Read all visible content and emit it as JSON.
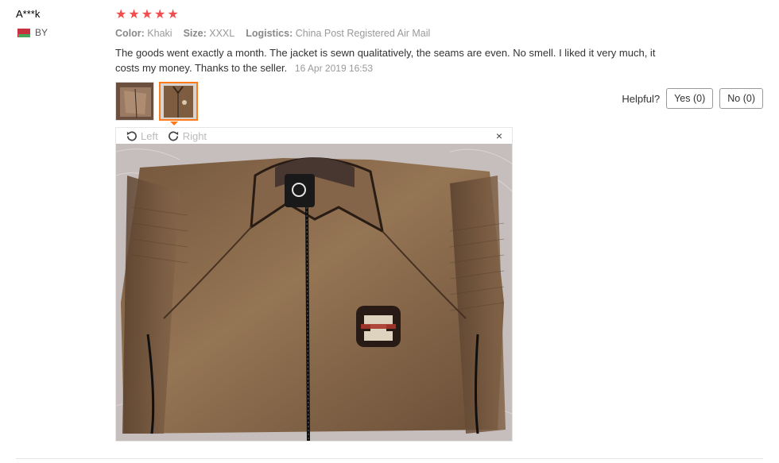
{
  "user": {
    "name": "A***k",
    "country_code": "BY"
  },
  "review": {
    "stars": [
      "★",
      "★",
      "★",
      "★",
      "★"
    ],
    "color_label": "Color:",
    "color_value": "Khaki",
    "size_label": "Size:",
    "size_value": "XXXL",
    "logistics_label": "Logistics:",
    "logistics_value": "China Post Registered Air Mail",
    "text": "The goods went exactly a month. The jacket is sewn qualitatively, the seams are even. No smell. I liked it very much, it costs my money. Thanks to the seller.",
    "date": "16 Apr 2019 16:53"
  },
  "helpful": {
    "label": "Helpful?",
    "yes": "Yes (0)",
    "no": "No (0)"
  },
  "viewer": {
    "rotate_left": "Left",
    "rotate_right": "Right",
    "close": "×"
  },
  "colors": {
    "star": "#f24c4c",
    "accent": "#ff7a1a",
    "jacket": "#8b6a4a"
  }
}
